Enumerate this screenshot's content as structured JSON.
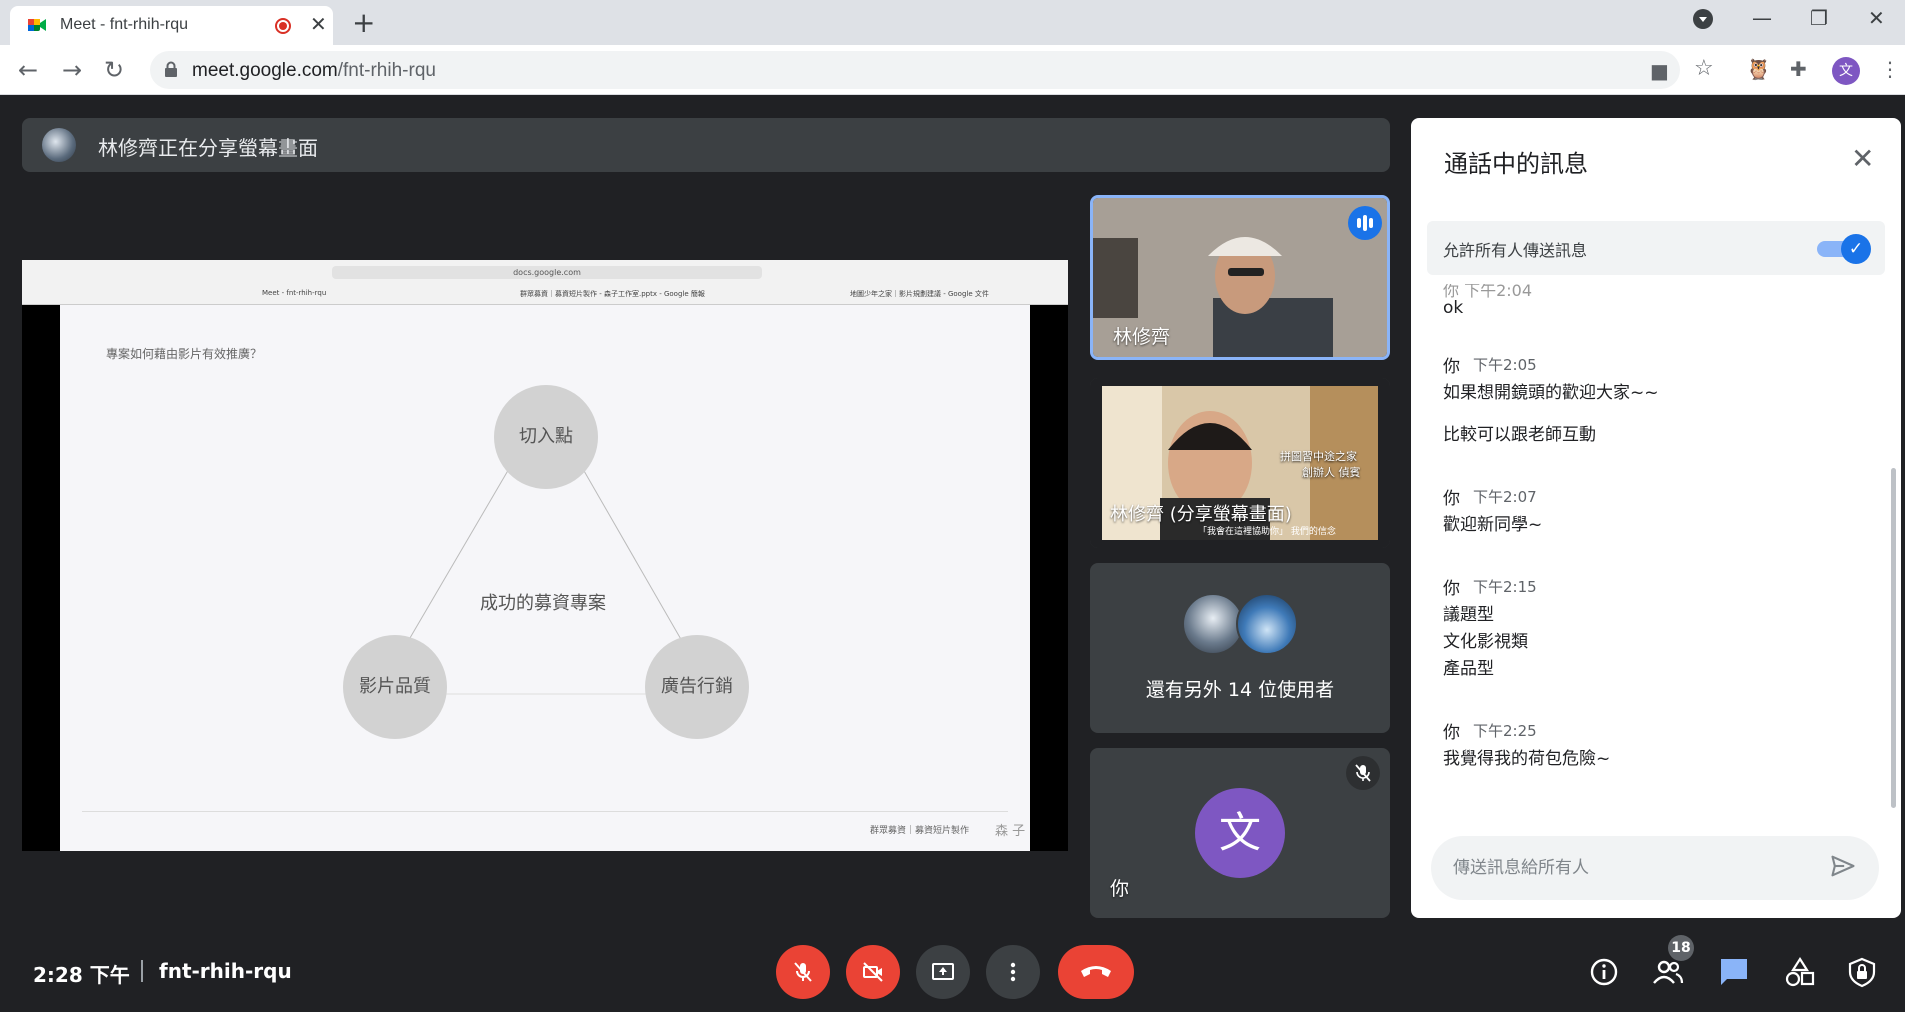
{
  "browser": {
    "tab_title": "Meet - fnt-rhih-rqu",
    "url_host": "meet.google.com",
    "url_path": "/fnt-rhih-rqu",
    "profile_initial": "文"
  },
  "meet": {
    "banner_text": "林修齊正在分享螢幕畫面",
    "shared_slide": {
      "mini_url": "docs.google.com",
      "mini_tabs": [
        "Meet - fnt-rhih-rqu",
        "群眾募資｜募資短片製作 - 森子工作室.pptx - Google 簡報",
        "地圖少年之家｜影片規劃建議 - Google 文件"
      ],
      "heading": "專案如何藉由影片有效推廣？",
      "top_circle": "切入點",
      "left_circle": "影片品質",
      "right_circle": "廣告行銷",
      "center_label": "成功的募資專案",
      "footer": "群眾募資｜募資短片製作",
      "signature": "森 子"
    },
    "tiles": [
      {
        "name": "林修齊"
      },
      {
        "name": "林修齊 (分享螢幕畫面)",
        "overlay_line1": "拼圖習中途之家",
        "overlay_line2": "創辦人 偵賓",
        "subtitle": "「我會在這裡協助你」 我們的信念"
      },
      {
        "name": "還有另外 14 位使用者"
      },
      {
        "name": "你",
        "avatar_initial": "文"
      }
    ]
  },
  "chat": {
    "title": "通話中的訊息",
    "allow_label": "允許所有人傳送訊息",
    "cut_text": "你  下午2:04",
    "messages": [
      {
        "sender": "",
        "time": "",
        "lines": [
          "ok"
        ]
      },
      {
        "sender": "你",
        "time": "下午2:05",
        "lines": [
          "如果想開鏡頭的歡迎大家~~",
          "比較可以跟老師互動"
        ]
      },
      {
        "sender": "你",
        "time": "下午2:07",
        "lines": [
          "歡迎新同學~"
        ]
      },
      {
        "sender": "你",
        "time": "下午2:15",
        "lines": [
          "議題型",
          "文化影視類",
          "產品型"
        ]
      },
      {
        "sender": "你",
        "time": "下午2:25",
        "lines": [
          "我覺得我的荷包危險~"
        ]
      }
    ],
    "input_placeholder": "傳送訊息給所有人"
  },
  "bottom_bar": {
    "time": "2:28 下午",
    "meeting_code": "fnt-rhih-rqu",
    "participant_count": "18"
  }
}
